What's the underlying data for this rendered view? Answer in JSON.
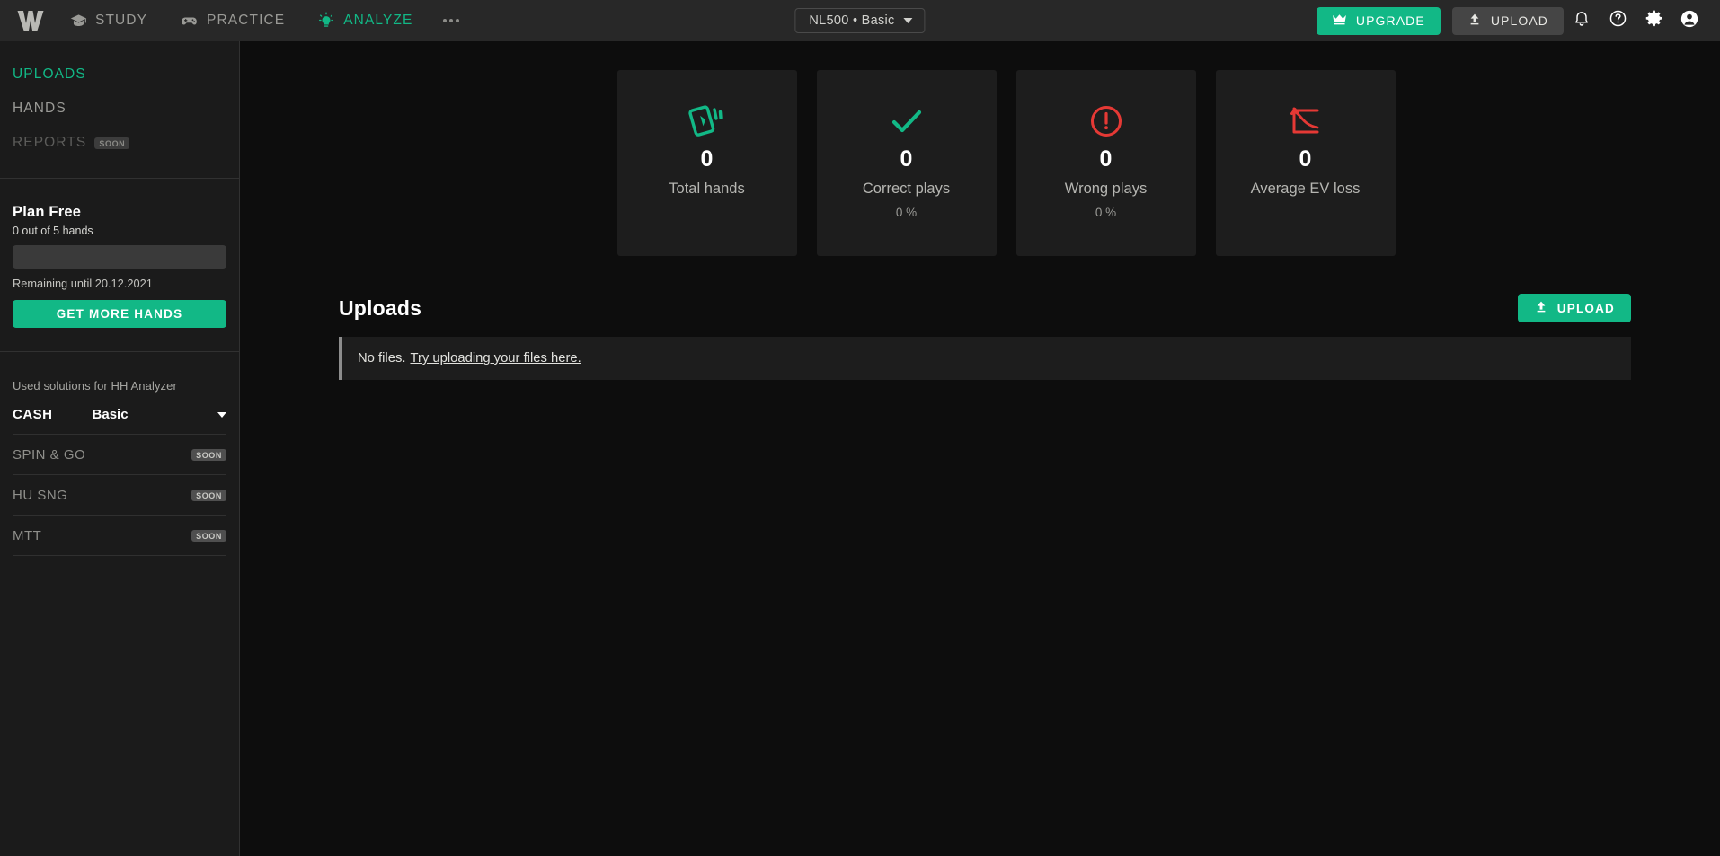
{
  "header": {
    "logo": "w-logo",
    "nav": [
      {
        "label": "STUDY",
        "icon": "graduation-cap-icon",
        "active": false
      },
      {
        "label": "PRACTICE",
        "icon": "gamepad-icon",
        "active": false
      },
      {
        "label": "ANALYZE",
        "icon": "lightbulb-icon",
        "active": true
      }
    ],
    "more_label": "more-options",
    "selector": {
      "value": "NL500 • Basic",
      "icon": "chevron-down-icon"
    },
    "upgrade_label": "UPGRADE",
    "upgrade_icon": "crown-icon",
    "upload_label": "UPLOAD",
    "upload_icon": "upload-arrow-icon",
    "icons": [
      "bell-icon",
      "help-circle-icon",
      "gear-icon",
      "account-circle-icon"
    ]
  },
  "sidebar": {
    "nav": [
      {
        "label": "UPLOADS",
        "active": true,
        "badge": ""
      },
      {
        "label": "HANDS",
        "active": false,
        "badge": ""
      },
      {
        "label": "REPORTS",
        "active": false,
        "badge": "SOON"
      }
    ],
    "plan": {
      "title": "Plan Free",
      "usage": "0 out of 5 hands",
      "progress_percent": 0,
      "remaining": "Remaining until 20.12.2021",
      "cta": "GET MORE HANDS"
    },
    "solutions": {
      "heading": "Used solutions for HH Analyzer",
      "rows": [
        {
          "name": "CASH",
          "value": "Basic",
          "badge": "",
          "has_caret": true
        },
        {
          "name": "SPIN & GO",
          "value": "",
          "badge": "SOON",
          "has_caret": false
        },
        {
          "name": "HU SNG",
          "value": "",
          "badge": "SOON",
          "has_caret": false
        },
        {
          "name": "MTT",
          "value": "",
          "badge": "SOON",
          "has_caret": false
        }
      ]
    }
  },
  "main": {
    "cards": [
      {
        "icon": "playing-cards-icon",
        "value": "0",
        "label": "Total hands",
        "percent": "",
        "color": "#12b886"
      },
      {
        "icon": "check-icon",
        "value": "0",
        "label": "Correct plays",
        "percent": "0 %",
        "color": "#12b886"
      },
      {
        "icon": "error-circle-icon",
        "value": "0",
        "label": "Wrong plays",
        "percent": "0 %",
        "color": "#e53935"
      },
      {
        "icon": "ev-loss-chart-icon",
        "value": "0",
        "label": "Average EV loss",
        "percent": "",
        "color": "#e53935"
      }
    ],
    "uploads": {
      "title": "Uploads",
      "upload_button": "UPLOAD",
      "upload_icon": "upload-arrow-icon",
      "empty_text": "No files.",
      "empty_link": "Try uploading your files here."
    }
  },
  "colors": {
    "accent": "#12b886",
    "danger": "#e53935",
    "header_bg": "#282828",
    "sidebar_bg": "#1b1b1b",
    "main_bg": "#0d0d0d",
    "card_bg": "#1d1d1d"
  }
}
